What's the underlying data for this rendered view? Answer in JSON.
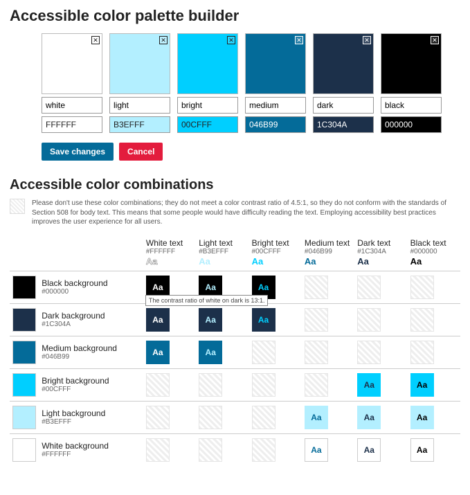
{
  "title": "Accessible color palette builder",
  "combosTitle": "Accessible color combinations",
  "note": "Please don't use these color combinations; they do not meet a color contrast ratio of 4.5:1, so they do not conform with the standards of Section 508 for body text. This means that some people would have difficulty reading the text. Employing accessibility best practices improves the user experience for all users.",
  "buttons": {
    "save": "Save changes",
    "cancel": "Cancel"
  },
  "sample": "Aa",
  "tooltip": "The contrast ratio of white on dark is 13:1.",
  "palette": [
    {
      "name": "white",
      "hex": "FFFFFF",
      "dark": false
    },
    {
      "name": "light",
      "hex": "B3EFFF",
      "dark": false
    },
    {
      "name": "bright",
      "hex": "00CFFF",
      "dark": false
    },
    {
      "name": "medium",
      "hex": "046B99",
      "dark": true
    },
    {
      "name": "dark",
      "hex": "1C304A",
      "dark": true
    },
    {
      "name": "black",
      "hex": "000000",
      "dark": true
    }
  ],
  "cols": [
    {
      "title": "White text",
      "hex": "#FFFFFF",
      "aaStyle": "outlined"
    },
    {
      "title": "Light text",
      "hex": "#B3EFFF",
      "aaColor": "#B3EFFF"
    },
    {
      "title": "Bright text",
      "hex": "#00CFFF",
      "aaColor": "#00CFFF"
    },
    {
      "title": "Medium text",
      "hex": "#046B99",
      "aaColor": "#046B99"
    },
    {
      "title": "Dark text",
      "hex": "#1C304A",
      "aaColor": "#1C304A"
    },
    {
      "title": "Black text",
      "hex": "#000000",
      "aaColor": "#000000"
    }
  ],
  "rows": [
    {
      "label": "Black background",
      "hex": "#000000",
      "bg": "#000000",
      "cells": [
        {
          "bg": "#000000",
          "fg": "#FFFFFF"
        },
        {
          "bg": "#000000",
          "fg": "#B3EFFF"
        },
        {
          "bg": "#000000",
          "fg": "#00CFFF"
        },
        null,
        null,
        null
      ]
    },
    {
      "label": "Dark background",
      "hex": "#1C304A",
      "bg": "#1C304A",
      "cells": [
        {
          "bg": "#1C304A",
          "fg": "#FFFFFF",
          "tooltip": true
        },
        {
          "bg": "#1C304A",
          "fg": "#B3EFFF"
        },
        {
          "bg": "#1C304A",
          "fg": "#00CFFF"
        },
        null,
        null,
        null
      ]
    },
    {
      "label": "Medium background",
      "hex": "#046B99",
      "bg": "#046B99",
      "cells": [
        {
          "bg": "#046B99",
          "fg": "#FFFFFF"
        },
        {
          "bg": "#046B99",
          "fg": "#B3EFFF"
        },
        null,
        null,
        null,
        null
      ]
    },
    {
      "label": "Bright background",
      "hex": "#00CFFF",
      "bg": "#00CFFF",
      "cells": [
        null,
        null,
        null,
        null,
        {
          "bg": "#00CFFF",
          "fg": "#1C304A"
        },
        {
          "bg": "#00CFFF",
          "fg": "#000000"
        }
      ]
    },
    {
      "label": "Light background",
      "hex": "#B3EFFF",
      "bg": "#B3EFFF",
      "cells": [
        null,
        null,
        null,
        {
          "bg": "#B3EFFF",
          "fg": "#046B99"
        },
        {
          "bg": "#B3EFFF",
          "fg": "#1C304A"
        },
        {
          "bg": "#B3EFFF",
          "fg": "#000000"
        }
      ]
    },
    {
      "label": "White background",
      "hex": "#FFFFFF",
      "bg": "#FFFFFF",
      "border": true,
      "cells": [
        null,
        null,
        null,
        {
          "bg": "#FFFFFF",
          "fg": "#046B99",
          "border": true
        },
        {
          "bg": "#FFFFFF",
          "fg": "#1C304A",
          "border": true
        },
        {
          "bg": "#FFFFFF",
          "fg": "#000000",
          "border": true
        }
      ]
    }
  ]
}
